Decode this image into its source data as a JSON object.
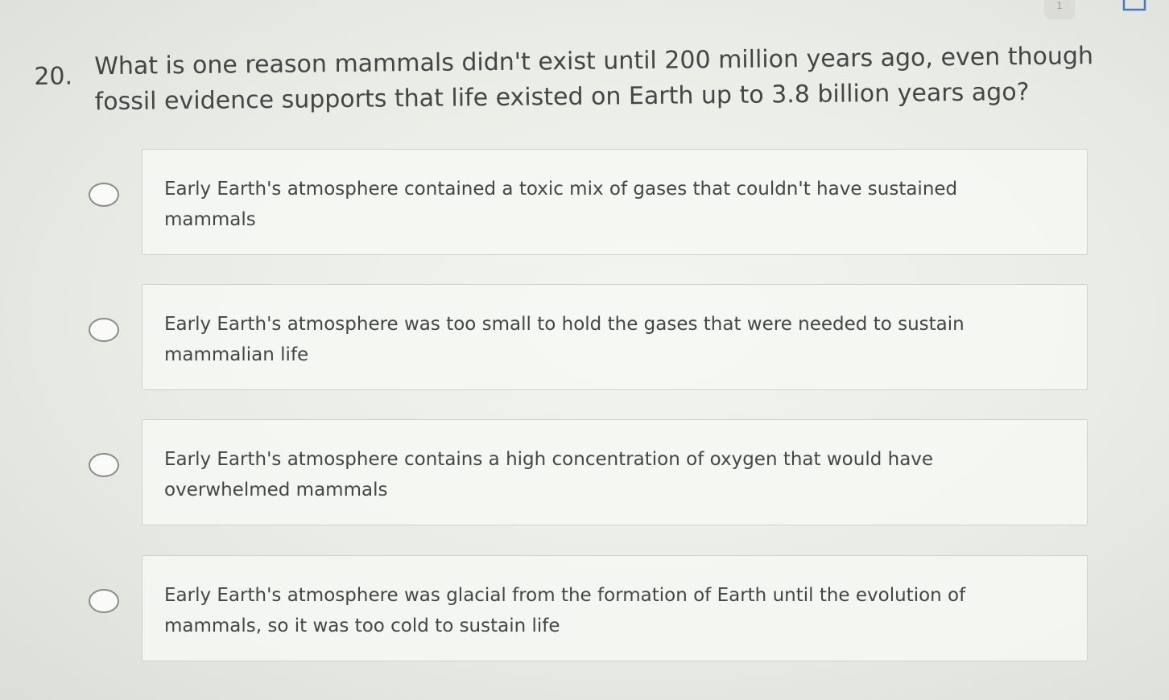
{
  "header": {
    "counter": "1"
  },
  "question": {
    "number": "20.",
    "text": "What is one reason mammals didn't exist until 200 million years ago, even though fossil evidence supports that life existed on Earth up to 3.8 billion years ago?"
  },
  "options": [
    {
      "text": "Early Earth's atmosphere contained a toxic mix of gases that couldn't have sustained mammals",
      "selected": false
    },
    {
      "text": "Early Earth's atmosphere was too small to hold the gases that were needed to sustain mammalian life",
      "selected": false
    },
    {
      "text": "Early Earth's atmosphere contains a high concentration of oxygen that would have overwhelmed mammals",
      "selected": false
    },
    {
      "text": "Early Earth's atmosphere was glacial from the formation of Earth until the evolution of mammals, so it was too cold to sustain life",
      "selected": false
    }
  ]
}
